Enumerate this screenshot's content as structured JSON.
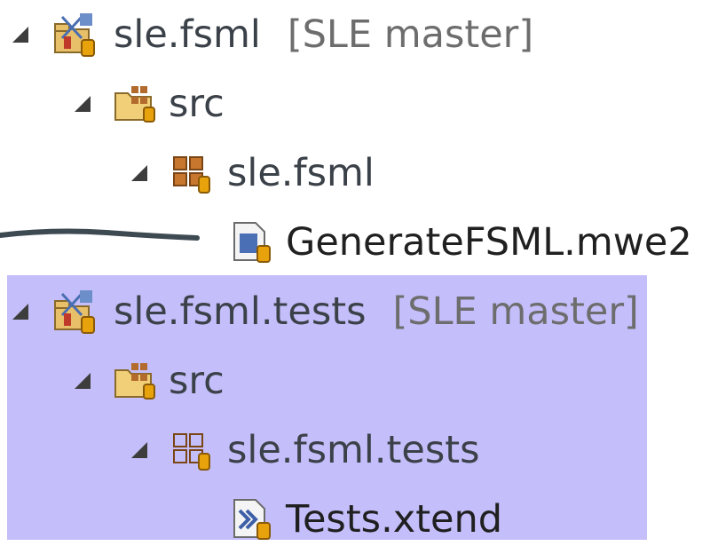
{
  "tree": {
    "nodes": [
      {
        "label": "sle.fsml",
        "decoration": "[SLE master]",
        "icon": "project-icon",
        "expanded": true
      },
      {
        "label": "src",
        "icon": "source-folder-icon",
        "expanded": true
      },
      {
        "label": "sle.fsml",
        "icon": "package-icon",
        "expanded": true
      },
      {
        "label": "GenerateFSML.mwe2",
        "icon": "mwe2-file-icon"
      },
      {
        "label": "sle.fsml.tests",
        "decoration": "[SLE master]",
        "icon": "project-icon",
        "expanded": true,
        "selected": true
      },
      {
        "label": "src",
        "icon": "source-folder-icon",
        "expanded": true,
        "selected": true
      },
      {
        "label": "sle.fsml.tests",
        "icon": "package-icon",
        "expanded": true,
        "selected": true
      },
      {
        "label": "Tests.xtend",
        "icon": "xtend-file-icon",
        "selected": true
      }
    ]
  },
  "colors": {
    "selection": "#c4befa",
    "label": "#3b4148",
    "decoration": "#6d6d6d",
    "connector": "#3e4a52"
  }
}
